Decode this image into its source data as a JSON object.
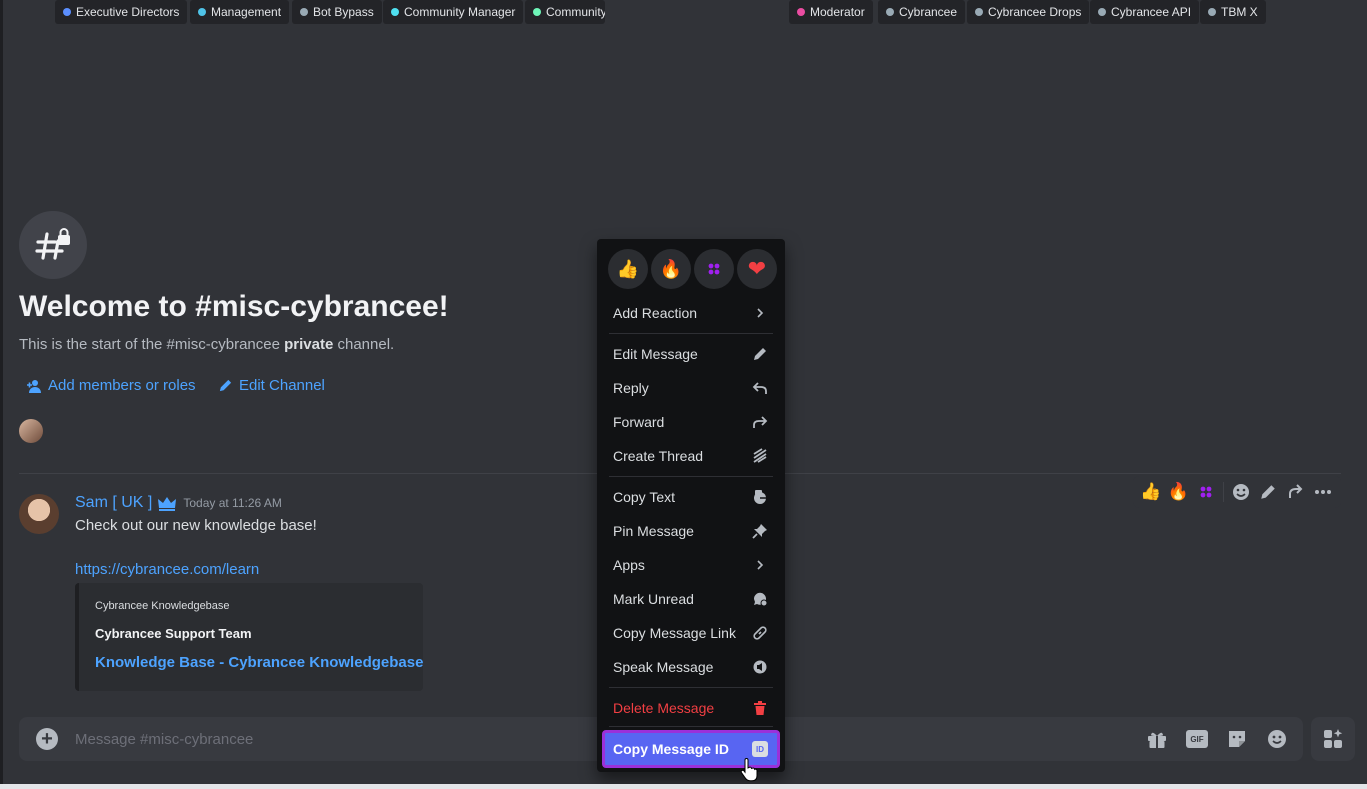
{
  "channel": {
    "title": "Welcome to #misc-cybrancee!",
    "desc_prefix": "This is the start of the #misc-cybrancee ",
    "desc_bold": "private",
    "desc_suffix": " channel.",
    "add_members_label": "Add members or roles",
    "edit_channel_label": "Edit Channel"
  },
  "roles": [
    {
      "name": "Executive Directors",
      "color": "#5b8fff"
    },
    {
      "name": "Management",
      "color": "#4fc3e8"
    },
    {
      "name": "Bot Bypass",
      "color": "#99aab5"
    },
    {
      "name": "Community Manager",
      "color": "#4fe0f0"
    },
    {
      "name": "Community",
      "color": "#6ef5b8"
    },
    {
      "name": "Moderator",
      "color": "#ea4ca1"
    },
    {
      "name": "Cybrancee",
      "color": "#99aab5"
    },
    {
      "name": "Cybrancee Drops",
      "color": "#99aab5"
    },
    {
      "name": "Cybrancee API",
      "color": "#99aab5"
    },
    {
      "name": "TBM X",
      "color": "#99aab5"
    }
  ],
  "message": {
    "author": "Sam [ UK ]",
    "timestamp": "Today at 11:26 AM",
    "text": "Check out our new knowledge base!",
    "link": "https://cybrancee.com/learn",
    "embed": {
      "provider": "Cybrancee Knowledgebase",
      "author": "Cybrancee Support Team",
      "title": "Knowledge Base - Cybrancee Knowledgebase"
    }
  },
  "hover_bar": {
    "icons": [
      "thumbs-up-icon",
      "fire-icon",
      "dots-emoji-icon",
      "add-reaction-icon",
      "edit-icon",
      "forward-icon",
      "more-icon"
    ]
  },
  "context_menu": {
    "quick_reactions": [
      "👍",
      "🔥",
      "⁘",
      "❤"
    ],
    "items": {
      "add_reaction": "Add Reaction",
      "edit_message": "Edit Message",
      "reply": "Reply",
      "forward": "Forward",
      "create_thread": "Create Thread",
      "copy_text": "Copy Text",
      "pin_message": "Pin Message",
      "apps": "Apps",
      "mark_unread": "Mark Unread",
      "copy_message_link": "Copy Message Link",
      "speak_message": "Speak Message",
      "delete_message": "Delete Message",
      "copy_message_id": "Copy Message ID"
    },
    "id_badge": "ID"
  },
  "composer": {
    "placeholder": "Message #misc-cybrancee",
    "icons": [
      "gift-icon",
      "gif-icon",
      "sticker-icon",
      "emoji-icon",
      "apps-icon"
    ],
    "gif_label": "GIF"
  },
  "colors": {
    "background": "#313338",
    "accent": "#5865f2",
    "link": "#4da3ff",
    "danger": "#f23f43",
    "highlight_border": "#9b30d9"
  }
}
